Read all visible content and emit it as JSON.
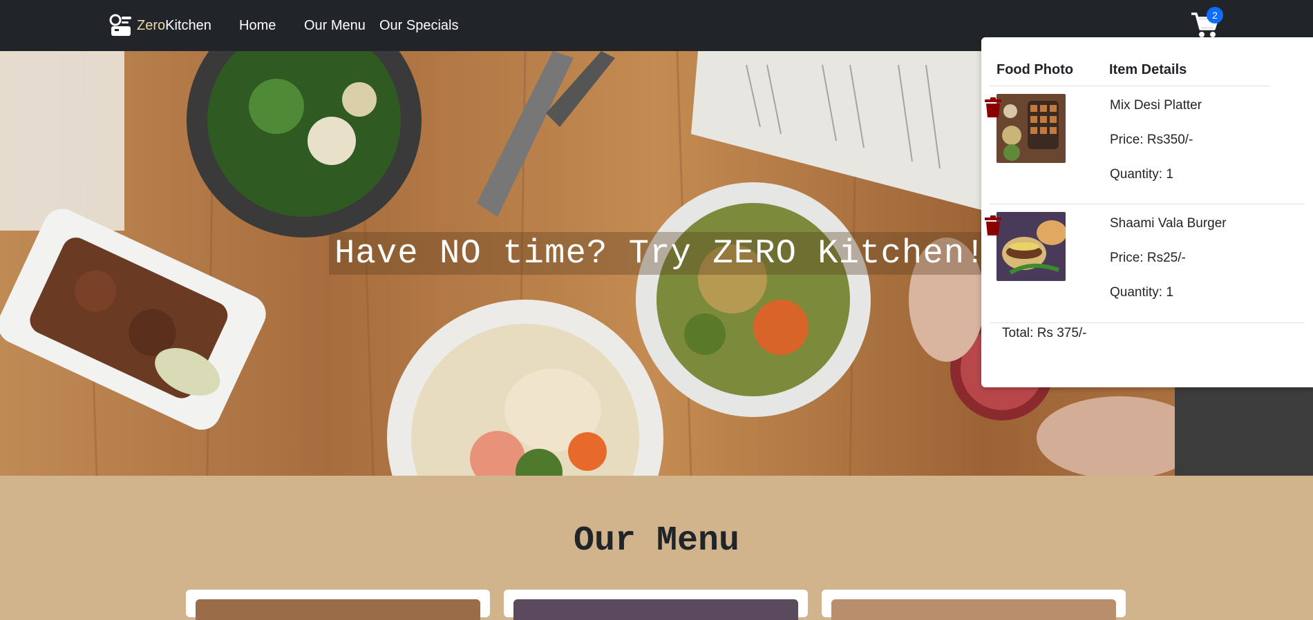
{
  "navbar": {
    "brand_zero": "Zero",
    "brand_kitchen": "Kitchen",
    "links": [
      "Home",
      "Our Menu",
      "Our Specials"
    ],
    "cart_count": "2"
  },
  "hero": {
    "headline": "Have NO time? Try ZERO Kitchen!"
  },
  "menu_section": {
    "title": "Our Menu"
  },
  "cart": {
    "headers": {
      "photo": "Food Photo",
      "details": "Item Details"
    },
    "items": [
      {
        "name": "Mix Desi Platter",
        "price": "Price: Rs350/-",
        "quantity": "Quantity: 1"
      },
      {
        "name": "Shaami Vala Burger",
        "price": "Price: Rs25/-",
        "quantity": "Quantity: 1"
      }
    ],
    "total": "Total: Rs 375/-"
  },
  "colors": {
    "navbar": "#212529",
    "section_bg": "#d2b48c",
    "badge": "#0d6efd",
    "trash": "#8b0000"
  },
  "icons": [
    "app-logo-icon",
    "cart-icon",
    "trash-icon"
  ]
}
